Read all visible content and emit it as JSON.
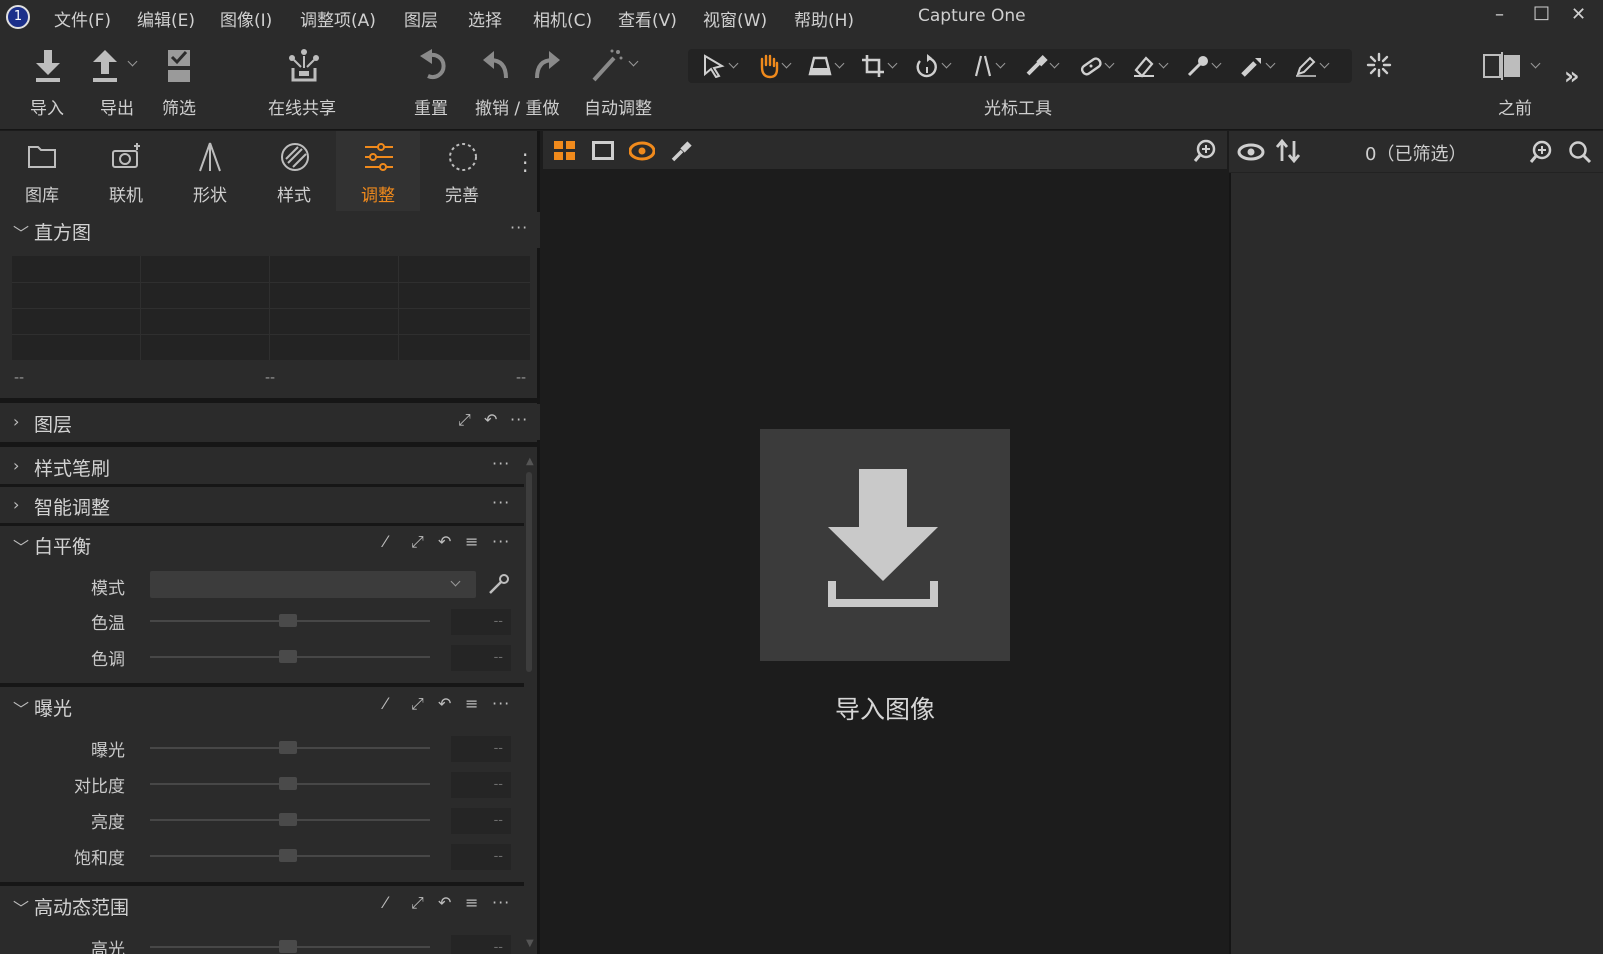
{
  "app": {
    "title": "Capture One",
    "logo_glyph": "1"
  },
  "menu": [
    "文件(F)",
    "编辑(E)",
    "图像(I)",
    "调整项(A)",
    "图层",
    "选择",
    "相机(C)",
    "查看(V)",
    "视窗(W)",
    "帮助(H)"
  ],
  "window_controls": {
    "minimize": "–",
    "maximize": "□",
    "close": "✕"
  },
  "toolbar": {
    "import": "导入",
    "export": "导出",
    "filter": "筛选",
    "share": "在线共享",
    "reset": "重置",
    "undo_redo": "撤销 / 重做",
    "auto_adjust": "自动调整",
    "cursor_tools": "光标工具",
    "before": "之前",
    "more": "»"
  },
  "left_tabs": [
    {
      "label": "图库",
      "icon": "folder-icon"
    },
    {
      "label": "联机",
      "icon": "camera-icon"
    },
    {
      "label": "形状",
      "icon": "compass-icon"
    },
    {
      "label": "样式",
      "icon": "style-icon"
    },
    {
      "label": "调整",
      "icon": "sliders-icon",
      "active": true
    },
    {
      "label": "完善",
      "icon": "refine-icon"
    }
  ],
  "histogram": {
    "title": "直方图",
    "ticks": [
      "--",
      "--",
      "--"
    ]
  },
  "sections": {
    "layers": "图层",
    "style_brushes": "样式笔刷",
    "smart_adjust": "智能调整",
    "white_balance": {
      "title": "白平衡",
      "rows": [
        {
          "label": "色温",
          "value": "--"
        },
        {
          "label": "色调",
          "value": "--"
        }
      ],
      "mode_label": "模式",
      "mode_value": ""
    },
    "exposure": {
      "title": "曝光",
      "rows": [
        {
          "label": "曝光",
          "value": "--"
        },
        {
          "label": "对比度",
          "value": "--"
        },
        {
          "label": "亮度",
          "value": "--"
        },
        {
          "label": "饱和度",
          "value": "--"
        }
      ]
    },
    "hdr": {
      "title": "高动态范围",
      "rows": [
        {
          "label": "高光",
          "value": "--"
        }
      ]
    }
  },
  "section_menu_glyph": "···",
  "viewer": {
    "import_label": "导入图像"
  },
  "browser": {
    "filter_count": "0（已筛选）"
  },
  "colors": {
    "accent": "#f08a1c",
    "panel": "#2b2b2b",
    "viewer": "#1c1c1c"
  }
}
